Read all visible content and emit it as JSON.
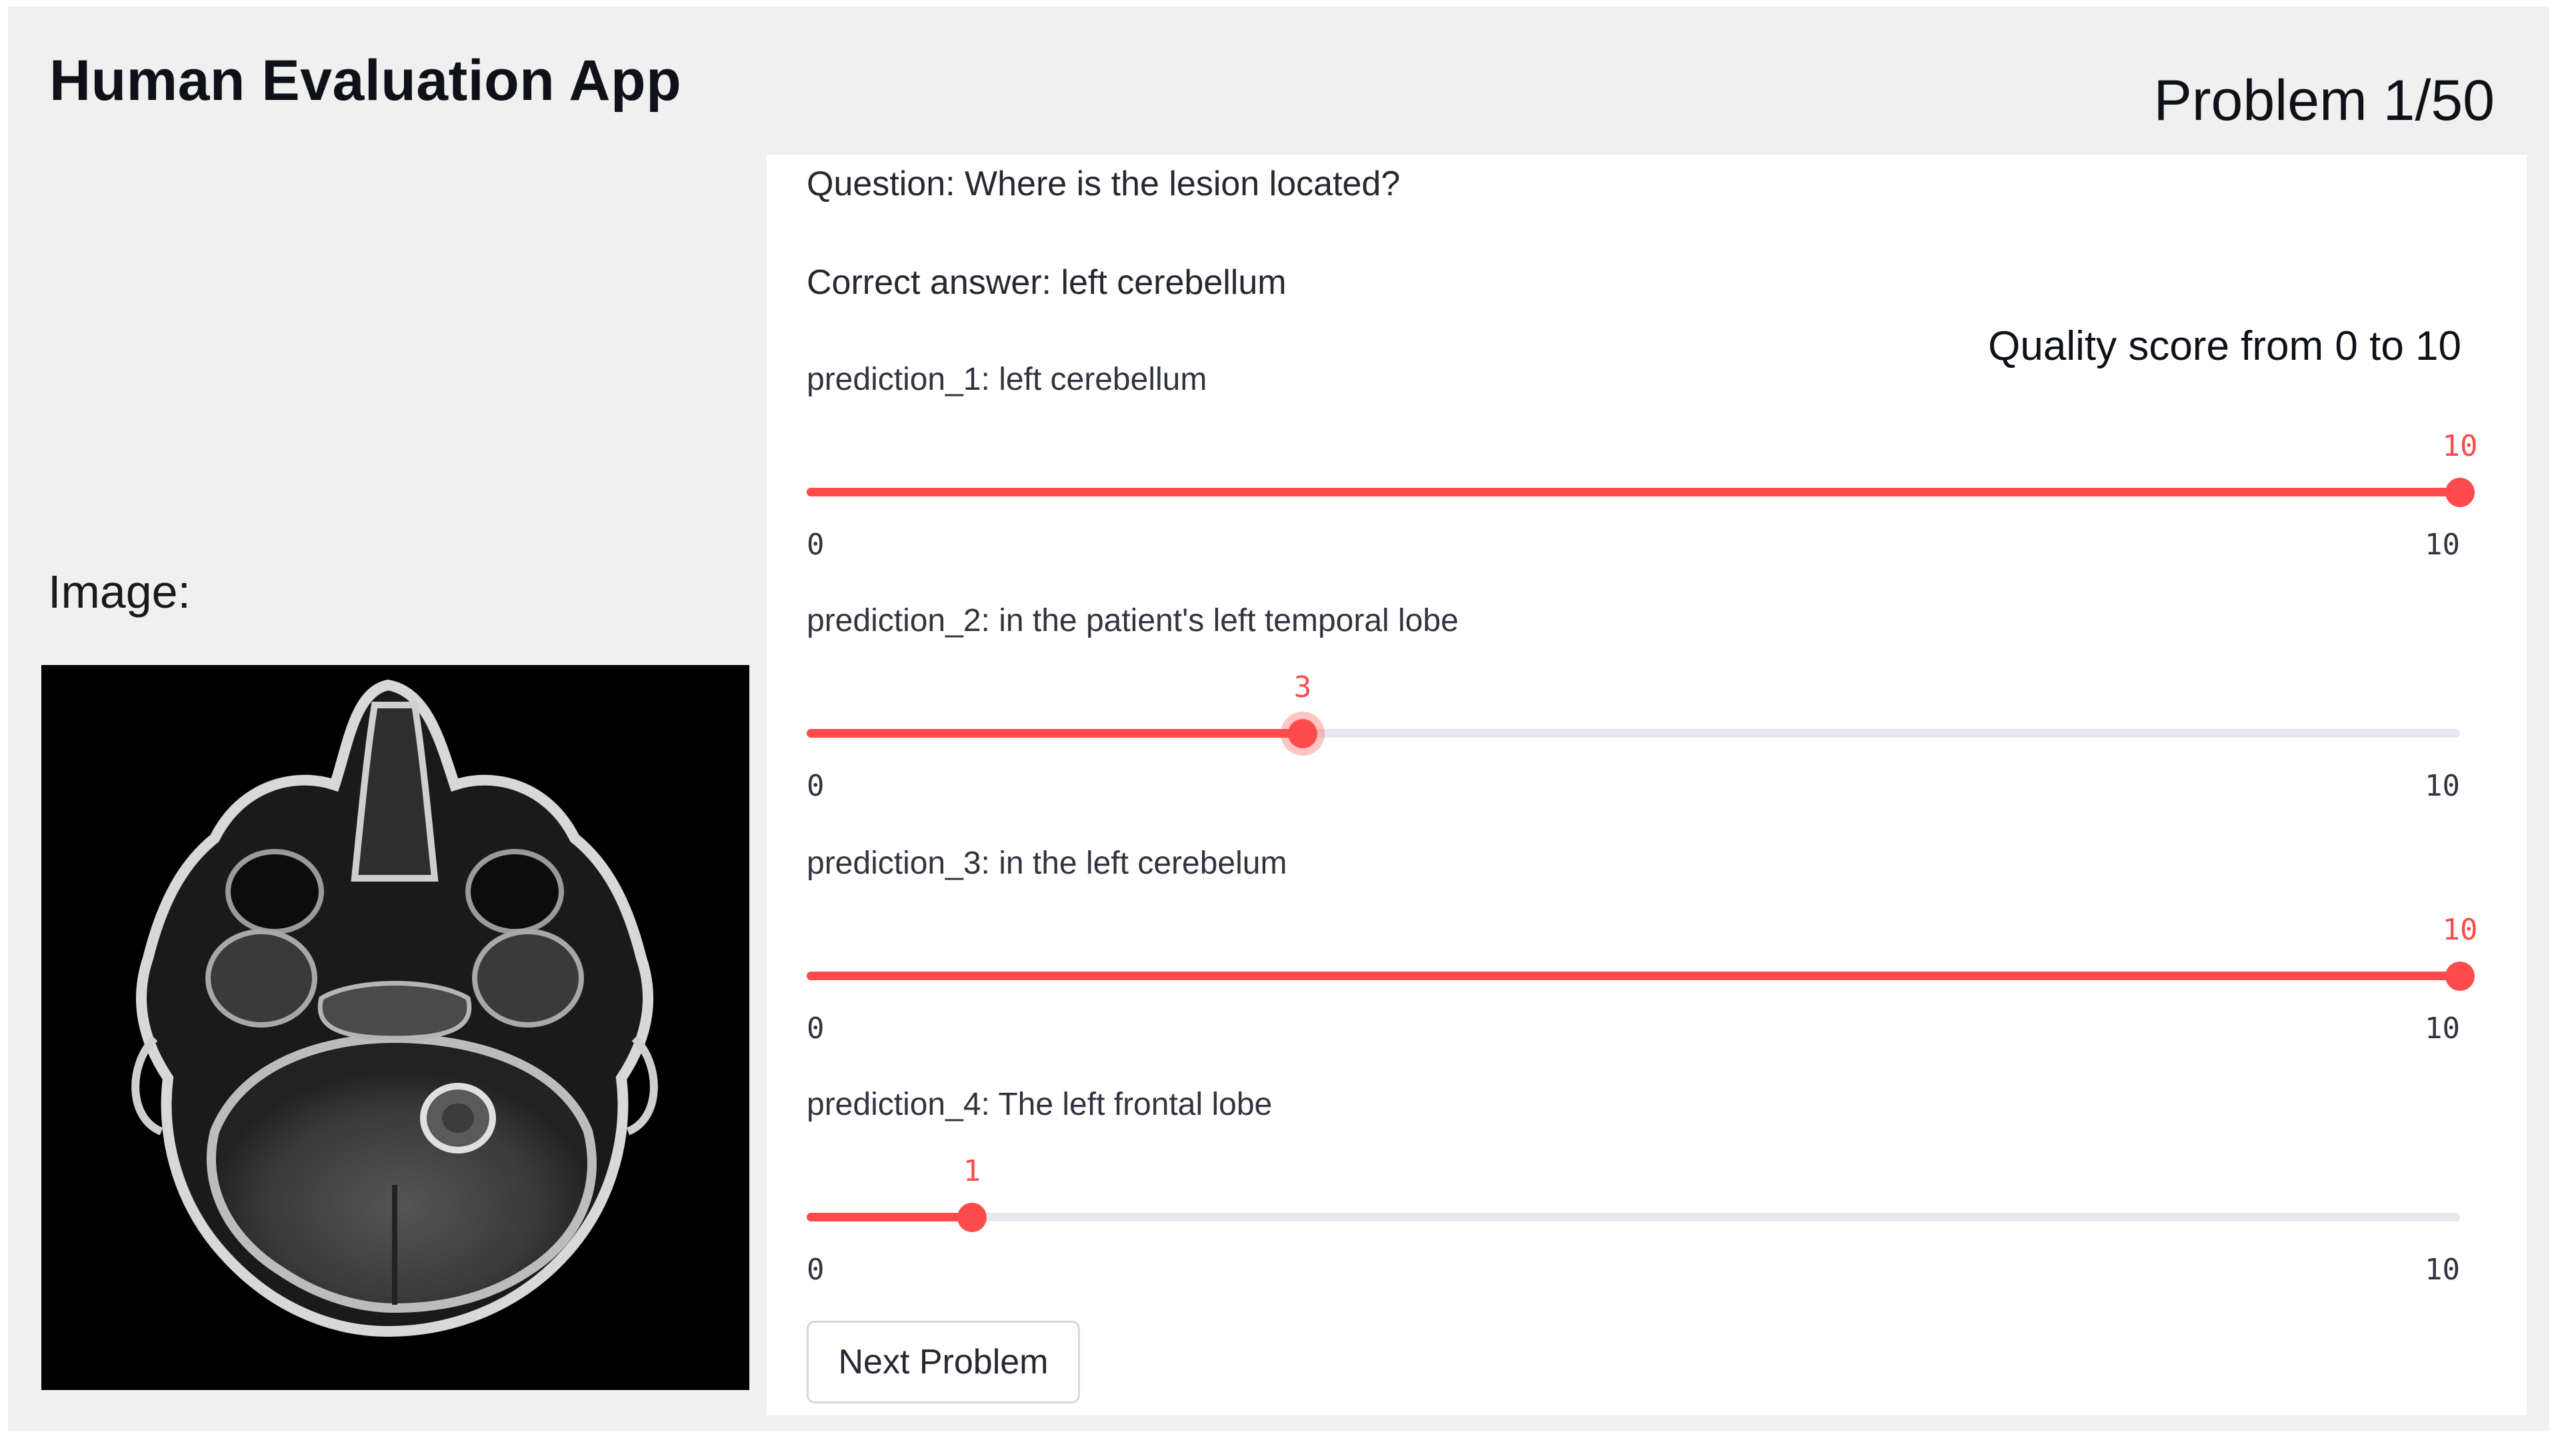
{
  "header": {
    "app_title": "Human Evaluation App",
    "problem_counter": "Problem 1/50"
  },
  "image_section": {
    "label": "Image:",
    "image_semantic": "brain-mri-axial-scan"
  },
  "panel": {
    "question": "Question: Where is the lesion located?",
    "correct_answer": "Correct answer: left cerebellum",
    "quality_heading": "Quality score from 0 to 10",
    "next_button_label": "Next Problem"
  },
  "sliders": [
    {
      "label": "prediction_1: left cerebellum",
      "value": 10,
      "value_text": "10",
      "min": 0,
      "max": 10,
      "min_text": "0",
      "max_text": "10"
    },
    {
      "label": "prediction_2: in the patient's left temporal lobe",
      "value": 3,
      "value_text": "3",
      "min": 0,
      "max": 10,
      "min_text": "0",
      "max_text": "10"
    },
    {
      "label": "prediction_3: in the left cerebelum",
      "value": 10,
      "value_text": "10",
      "min": 0,
      "max": 10,
      "min_text": "0",
      "max_text": "10"
    },
    {
      "label": "prediction_4: The left frontal lobe",
      "value": 1,
      "value_text": "1",
      "min": 0,
      "max": 10,
      "min_text": "0",
      "max_text": "10"
    }
  ],
  "colors": {
    "accent": "#ff4b4b",
    "track": "#e6e8ee",
    "background": "#f0f0f0",
    "panel": "#ffffff"
  }
}
